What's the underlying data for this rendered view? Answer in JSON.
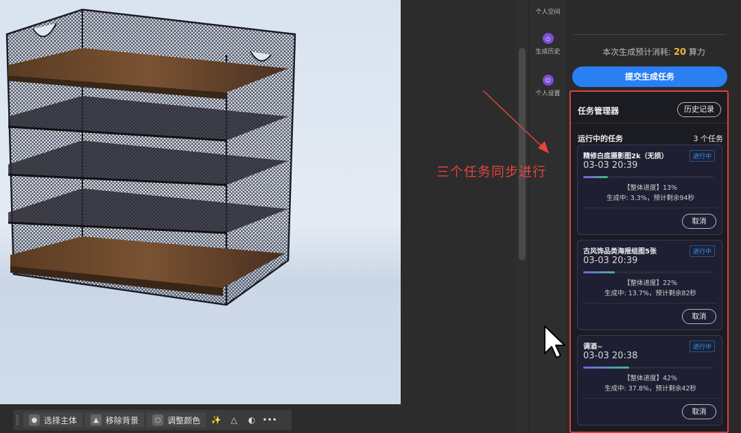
{
  "rail": {
    "items": [
      {
        "label": "个人空间"
      },
      {
        "label": "生成历史"
      },
      {
        "label": "个人设置"
      }
    ]
  },
  "panel": {
    "cost_prefix": "本次生成预计消耗:",
    "cost_value": "20",
    "cost_unit": "算力",
    "submit_label": "提交生成任务"
  },
  "task_manager": {
    "title": "任务管理器",
    "history_label": "历史记录",
    "running_label": "运行中的任务",
    "running_count": "3 个任务",
    "tasks": [
      {
        "name": "精修白底摄影图2k（无损）",
        "status": "进行中",
        "time": "03-03 20:39",
        "progress_text": "【整体进度】13%",
        "progress": 0.13,
        "detail": "生成中: 3.3%，预计剩余94秒",
        "cancel_label": "取消"
      },
      {
        "name": "古风饰品类海报组图5张",
        "status": "进行中",
        "time": "03-03 20:39",
        "progress_text": "【整体进度】22%",
        "progress": 0.22,
        "detail": "生成中: 13.7%，预计剩余82秒",
        "cancel_label": "取消"
      },
      {
        "name": "调酒~",
        "status": "进行中",
        "time": "03-03 20:38",
        "progress_text": "【整体进度】42%",
        "progress": 0.42,
        "detail": "生成中: 37.8%，预计剩余42秒",
        "cancel_label": "取消"
      }
    ]
  },
  "toolbar": {
    "select_subject": "选择主体",
    "remove_background": "移除背景",
    "adjust_color": "调整颜色",
    "more": "•••"
  },
  "annotation": {
    "text": "三个任务同步进行",
    "color": "#e5433f"
  },
  "colors": {
    "accent": "#2a7ff3",
    "cost": "#f1b53a",
    "highlight_border": "#e0413f"
  }
}
